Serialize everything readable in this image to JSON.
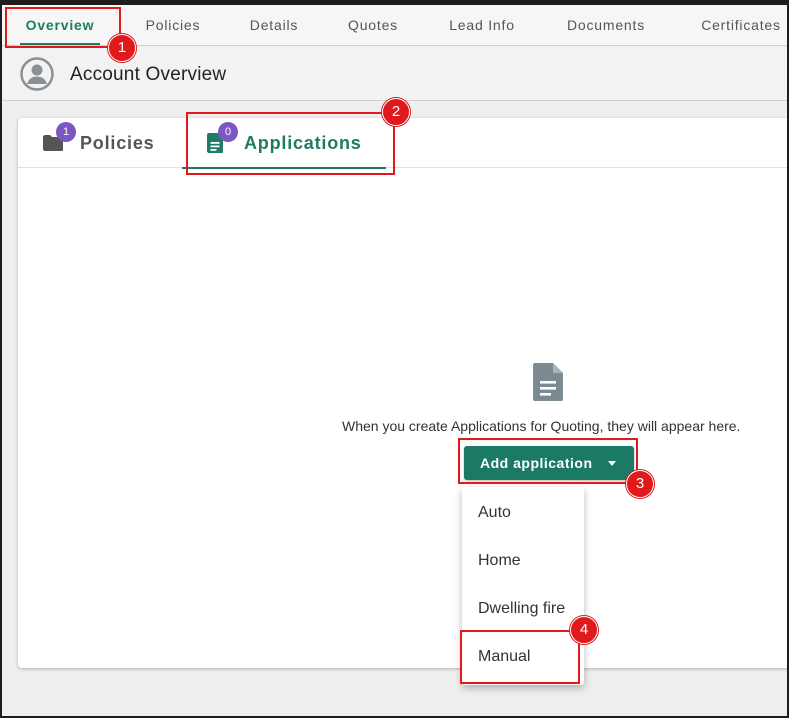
{
  "top_nav": {
    "tabs": [
      {
        "label": "Overview",
        "active": true
      },
      {
        "label": "Policies"
      },
      {
        "label": "Details"
      },
      {
        "label": "Quotes"
      },
      {
        "label": "Lead Info"
      },
      {
        "label": "Documents"
      },
      {
        "label": "Certificates"
      }
    ]
  },
  "account": {
    "title": "Account Overview",
    "icon": "account-circle-icon"
  },
  "card": {
    "tabs": [
      {
        "label": "Policies",
        "badge": "1",
        "icon": "folder-icon"
      },
      {
        "label": "Applications",
        "badge": "0",
        "icon": "document-icon",
        "active": true
      }
    ],
    "empty_state": {
      "icon": "document-icon",
      "message": "When you create Applications for Quoting, they will appear here."
    },
    "add_button": {
      "label": "Add application",
      "icon": "caret-down-icon"
    },
    "dropdown": {
      "items": [
        "Auto",
        "Home",
        "Dwelling fire",
        "Manual"
      ]
    }
  },
  "annotations": {
    "markers": [
      "1",
      "2",
      "3",
      "4"
    ]
  },
  "colors": {
    "accent": "#1f7a66",
    "button": "#1a7a63",
    "badge": "#7c56c4",
    "annotation": "#e0191d"
  }
}
